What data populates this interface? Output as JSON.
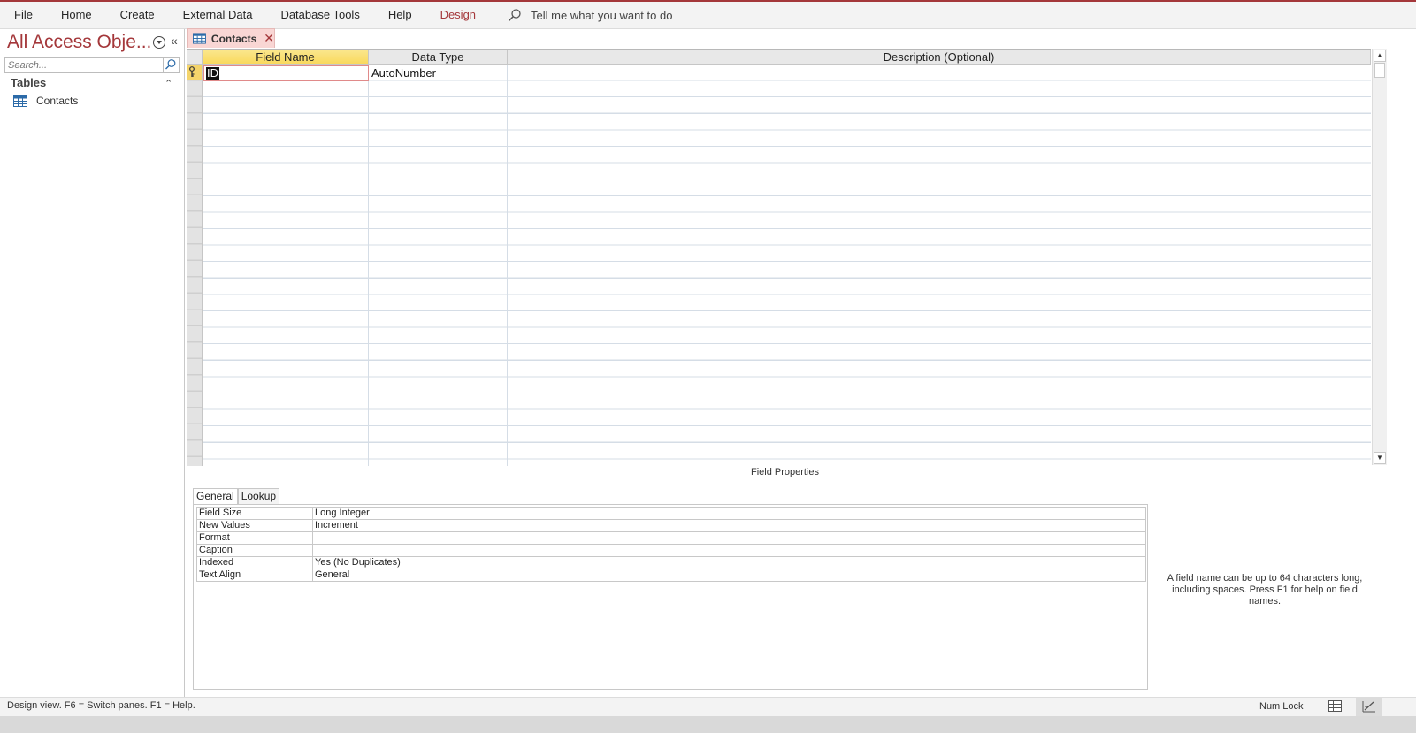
{
  "ribbon": {
    "tabs": [
      "File",
      "Home",
      "Create",
      "External Data",
      "Database Tools",
      "Help",
      "Design"
    ],
    "active_tab": "Design",
    "tell_me": "Tell me what you want to do"
  },
  "nav": {
    "title": "All Access Obje...",
    "search_placeholder": "Search...",
    "group": "Tables",
    "items": [
      {
        "label": "Contacts",
        "icon": "table-icon"
      }
    ]
  },
  "document_tab": {
    "label": "Contacts"
  },
  "grid": {
    "headers": [
      "Field Name",
      "Data Type",
      "Description (Optional)"
    ],
    "rows": [
      {
        "field_name": "ID",
        "data_type": "AutoNumber",
        "description": "",
        "primary_key": true
      }
    ]
  },
  "field_properties": {
    "title": "Field Properties",
    "tabs": [
      "General",
      "Lookup"
    ],
    "active_tab": "General",
    "rows": [
      {
        "key": "Field Size",
        "value": "Long Integer"
      },
      {
        "key": "New Values",
        "value": "Increment"
      },
      {
        "key": "Format",
        "value": ""
      },
      {
        "key": "Caption",
        "value": ""
      },
      {
        "key": "Indexed",
        "value": "Yes (No Duplicates)"
      },
      {
        "key": "Text Align",
        "value": "General"
      }
    ],
    "help": "A field name can be up to 64 characters long, including spaces. Press F1 for help on field names."
  },
  "status": {
    "message": "Design view.  F6 = Switch panes.  F1 = Help.",
    "num_lock": "Num Lock"
  },
  "colors": {
    "accent": "#a4373a",
    "header_selected": "#f9d95d",
    "tab_bg": "#f9d6d4"
  }
}
